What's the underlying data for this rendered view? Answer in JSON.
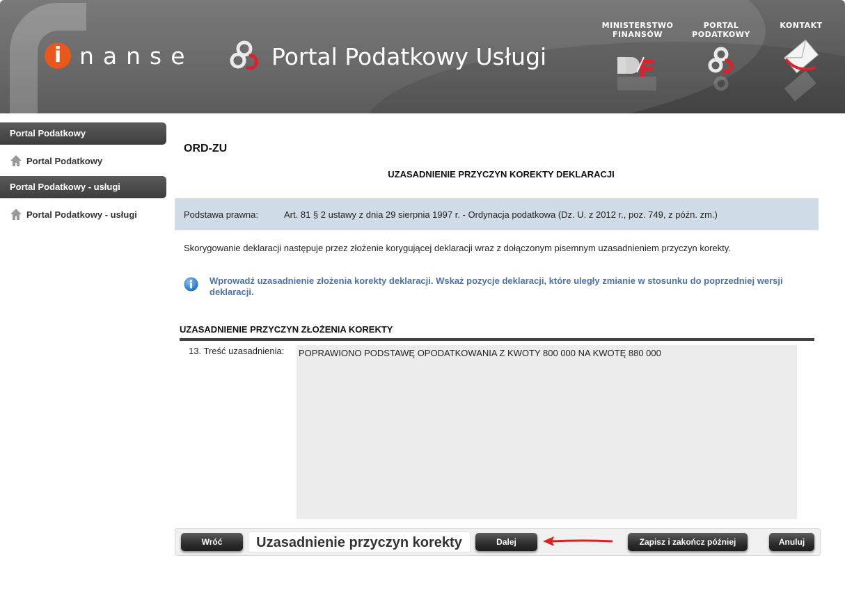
{
  "header": {
    "logo_letter": "i",
    "logo_rest": "nanse",
    "portal_title": "Portal Podatkowy Usługi",
    "links": [
      {
        "line1": "MINISTERSTWO",
        "line2": "FINANSÓW"
      },
      {
        "line1": "PORTAL",
        "line2": "PODATKOWY"
      },
      {
        "line1": "KONTAKT",
        "line2": ""
      }
    ],
    "colors": {
      "accent": "#e8571b",
      "red": "#d9232d"
    }
  },
  "sidebar": {
    "sections": [
      {
        "title": "Portal Podatkowy",
        "item": "Portal Podatkowy"
      },
      {
        "title": "Portal Podatkowy - usługi",
        "item": "Portal Podatkowy - usługi"
      }
    ]
  },
  "main": {
    "form_code": "ORD-ZU",
    "form_title": "UZASADNIENIE PRZYCZYN KOREKTY DEKLARACJI",
    "legal_label": "Podstawa prawna:",
    "legal_text": "Art. 81 § 2 ustawy z dnia 29 sierpnia 1997 r. - Ordynacja podatkowa (Dz. U. z 2012 r., poz. 749, z późn. zm.)",
    "info_text": "Skorygowanie deklaracji następuje przez złożenie korygującej deklaracji wraz z dołączonym pisemnym uzasadnieniem przyczyn korekty.",
    "hint_text": "Wprowadź uzasadnienie złożenia korekty deklaracji. Wskaż pozycje deklaracji, które uległy zmianie w stosunku do poprzedniej wersji deklaracji.",
    "section_title": "UZASADNIENIE PRZYCZYN ZŁOŻENIA KOREKTY",
    "field_label": "13. Treść uzasadnienia:",
    "field_value": "POPRAWIONO PODSTAWĘ OPODATKOWANIA Z KWOTY 800 000 NA KWOTĘ 880 000"
  },
  "toolbar": {
    "back_label": "Wróć",
    "step_title": "Uzasadnienie przyczyn korekty",
    "next_label": "Dalej",
    "save_later_label": "Zapisz i zakończ później",
    "cancel_label": "Anuluj"
  }
}
